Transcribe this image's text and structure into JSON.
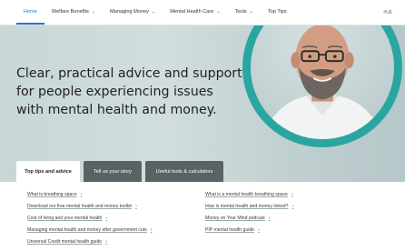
{
  "nav": {
    "items": [
      {
        "label": "Home",
        "has_dropdown": false,
        "active": true
      },
      {
        "label": "Welfare Benefits",
        "has_dropdown": true,
        "active": false
      },
      {
        "label": "Managing Money",
        "has_dropdown": true,
        "active": false
      },
      {
        "label": "Mental Health Care",
        "has_dropdown": true,
        "active": false
      },
      {
        "label": "Tools",
        "has_dropdown": true,
        "active": false
      },
      {
        "label": "Top Tips",
        "has_dropdown": false,
        "active": false
      }
    ],
    "utility_label": "#UE"
  },
  "hero": {
    "heading": "Clear, practical advice and support for people experiencing issues with mental health and money.",
    "ring_color": "#2aa6a0"
  },
  "tabs": [
    {
      "label": "Top tips and advice",
      "selected": true
    },
    {
      "label": "Tell us your story",
      "selected": false
    },
    {
      "label": "Useful tools & calculators",
      "selected": false
    }
  ],
  "links": {
    "left": [
      "What is breathing space",
      "Download our free mental health and money toolkit",
      "Cost of living and your mental health",
      "Managing mental health and money after government cuts",
      "Universal Credit mental health guide"
    ],
    "right": [
      "What is a mental health breathing space",
      "How is mental health and money linked?",
      "Money on Your Mind podcast",
      "PIP mental health guide"
    ]
  },
  "colors": {
    "accent": "#2f6fd1",
    "tab_dark": "#5b6265",
    "hero_bg": "#c7d6d6"
  }
}
